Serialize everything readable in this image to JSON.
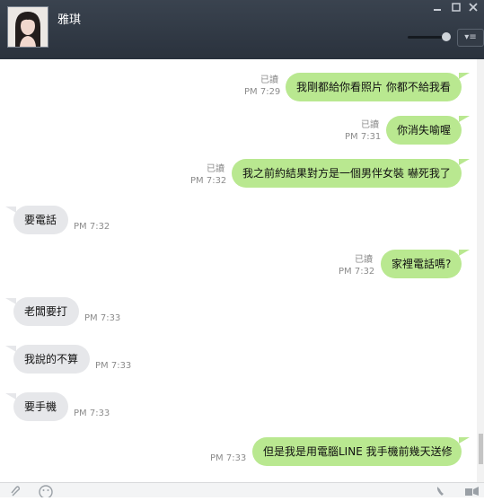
{
  "window": {
    "contact_name": "雅琪",
    "minimize_icon": "minimize-icon",
    "maximize_icon": "maximize-icon",
    "close_icon": "close-icon"
  },
  "toolbar": {
    "menu_icon": "menu-dropdown-icon",
    "menu_glyph": "▾≡"
  },
  "messages": [
    {
      "direction": "out",
      "text": "我剛都給你看照片 你都不給我看",
      "read": "已讀",
      "time": "PM 7:29"
    },
    {
      "direction": "out",
      "text": "你消失喻喔",
      "read": "已讀",
      "time": "PM 7:31"
    },
    {
      "direction": "out",
      "text": "我之前約結果對方是一個男伴女裝 嚇死我了",
      "read": "已讀",
      "time": "PM 7:32"
    },
    {
      "direction": "in",
      "text": "要電話",
      "time": "PM 7:32"
    },
    {
      "direction": "out",
      "text": "家裡電話嗎?",
      "read": "已讀",
      "time": "PM 7:32"
    },
    {
      "direction": "in",
      "text": "老闆要打",
      "time": "PM 7:33"
    },
    {
      "direction": "in",
      "text": "我說的不算",
      "time": "PM 7:33"
    },
    {
      "direction": "in",
      "text": "要手機",
      "time": "PM 7:33"
    },
    {
      "direction": "out",
      "text": "但是我是用電腦LINE 我手機前幾天送修",
      "time": "PM 7:33"
    }
  ],
  "footer": {
    "attach_icon": "paperclip-icon",
    "emoji_icon": "smiley-icon",
    "call_icon": "phone-icon",
    "more_icon": "more-icon"
  }
}
